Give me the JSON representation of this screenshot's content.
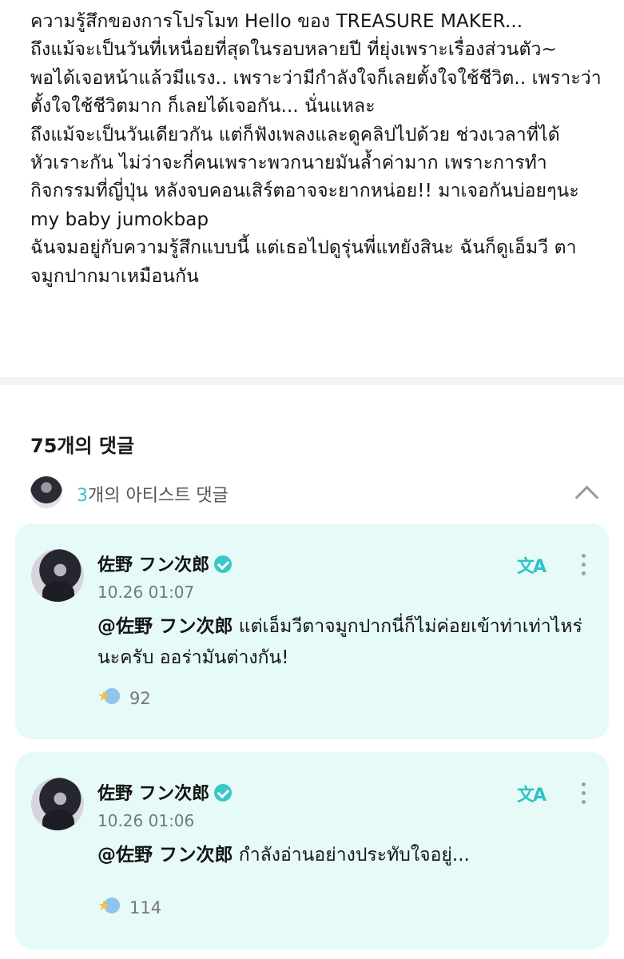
{
  "post": {
    "body": "ความรู้สึกของการโปรโมท Hello ของ TREASURE MAKER...\nถึงแม้จะเป็นวันที่เหนื่อยที่สุดในรอบหลายปี ที่ยุ่งเพราะเรื่องส่วนตัว~ พอได้เจอหน้าแล้วมีแรง.. เพราะว่ามีกำลังใจก็เลยตั้งใจใช้ชีวิต.. เพราะว่าตั้งใจใช้ชีวิตมาก ก็เลยได้เจอกัน... นั่นแหละ\nถึงแม้จะเป็นวันเดียวกัน แต่ก็ฟังเพลงและดูคลิปไปด้วย ช่วงเวลาที่ได้หัวเราะกัน ไม่ว่าจะกี่คนเพราะพวกนายมันล้ำค่ามาก เพราะการทำกิจกรรมที่ญี่ปุ่น หลังจบคอนเสิร์ตอาจจะยากหน่อย!! มาเจอกันบ่อยๆนะ my baby jumokbap\nฉันจมอยู่กับความรู้สึกแบบนี้ แต่เธอไปดูรุ่นพี่แทยังสินะ ฉันก็ดูเอ็มวี ตาจมูกปากมาเหมือนกัน"
  },
  "comments_header": {
    "count_label": "75개의 댓글"
  },
  "artist_comments": {
    "count": "3",
    "label": "개의 아티스트 댓글"
  },
  "comments": [
    {
      "name": "佐野 フン次郎",
      "timestamp": "10.26 01:07",
      "mention": "@佐野 フン次郎",
      "text": "แต่เอ็มวีตาจมูกปากนี่ก็ไม่ค่อยเข้าท่าเท่าไหร่นะครับ ออร่ามันต่างกัน!",
      "likes": "92"
    },
    {
      "name": "佐野 フン次郎",
      "timestamp": "10.26 01:06",
      "mention": "@佐野 フン次郎",
      "text": "กำลังอ่านอย่างประทับใจอยู่...",
      "likes": "114"
    }
  ],
  "icons": {
    "translate": "translate-icon",
    "more": "more-vertical-icon",
    "verified": "verified-badge-icon",
    "like": "like-icon",
    "chevron": "chevron-up-icon"
  },
  "colors": {
    "accent": "#2fc2c7",
    "card_bg": "#e6faf8",
    "divider": "#f3f3f4"
  }
}
